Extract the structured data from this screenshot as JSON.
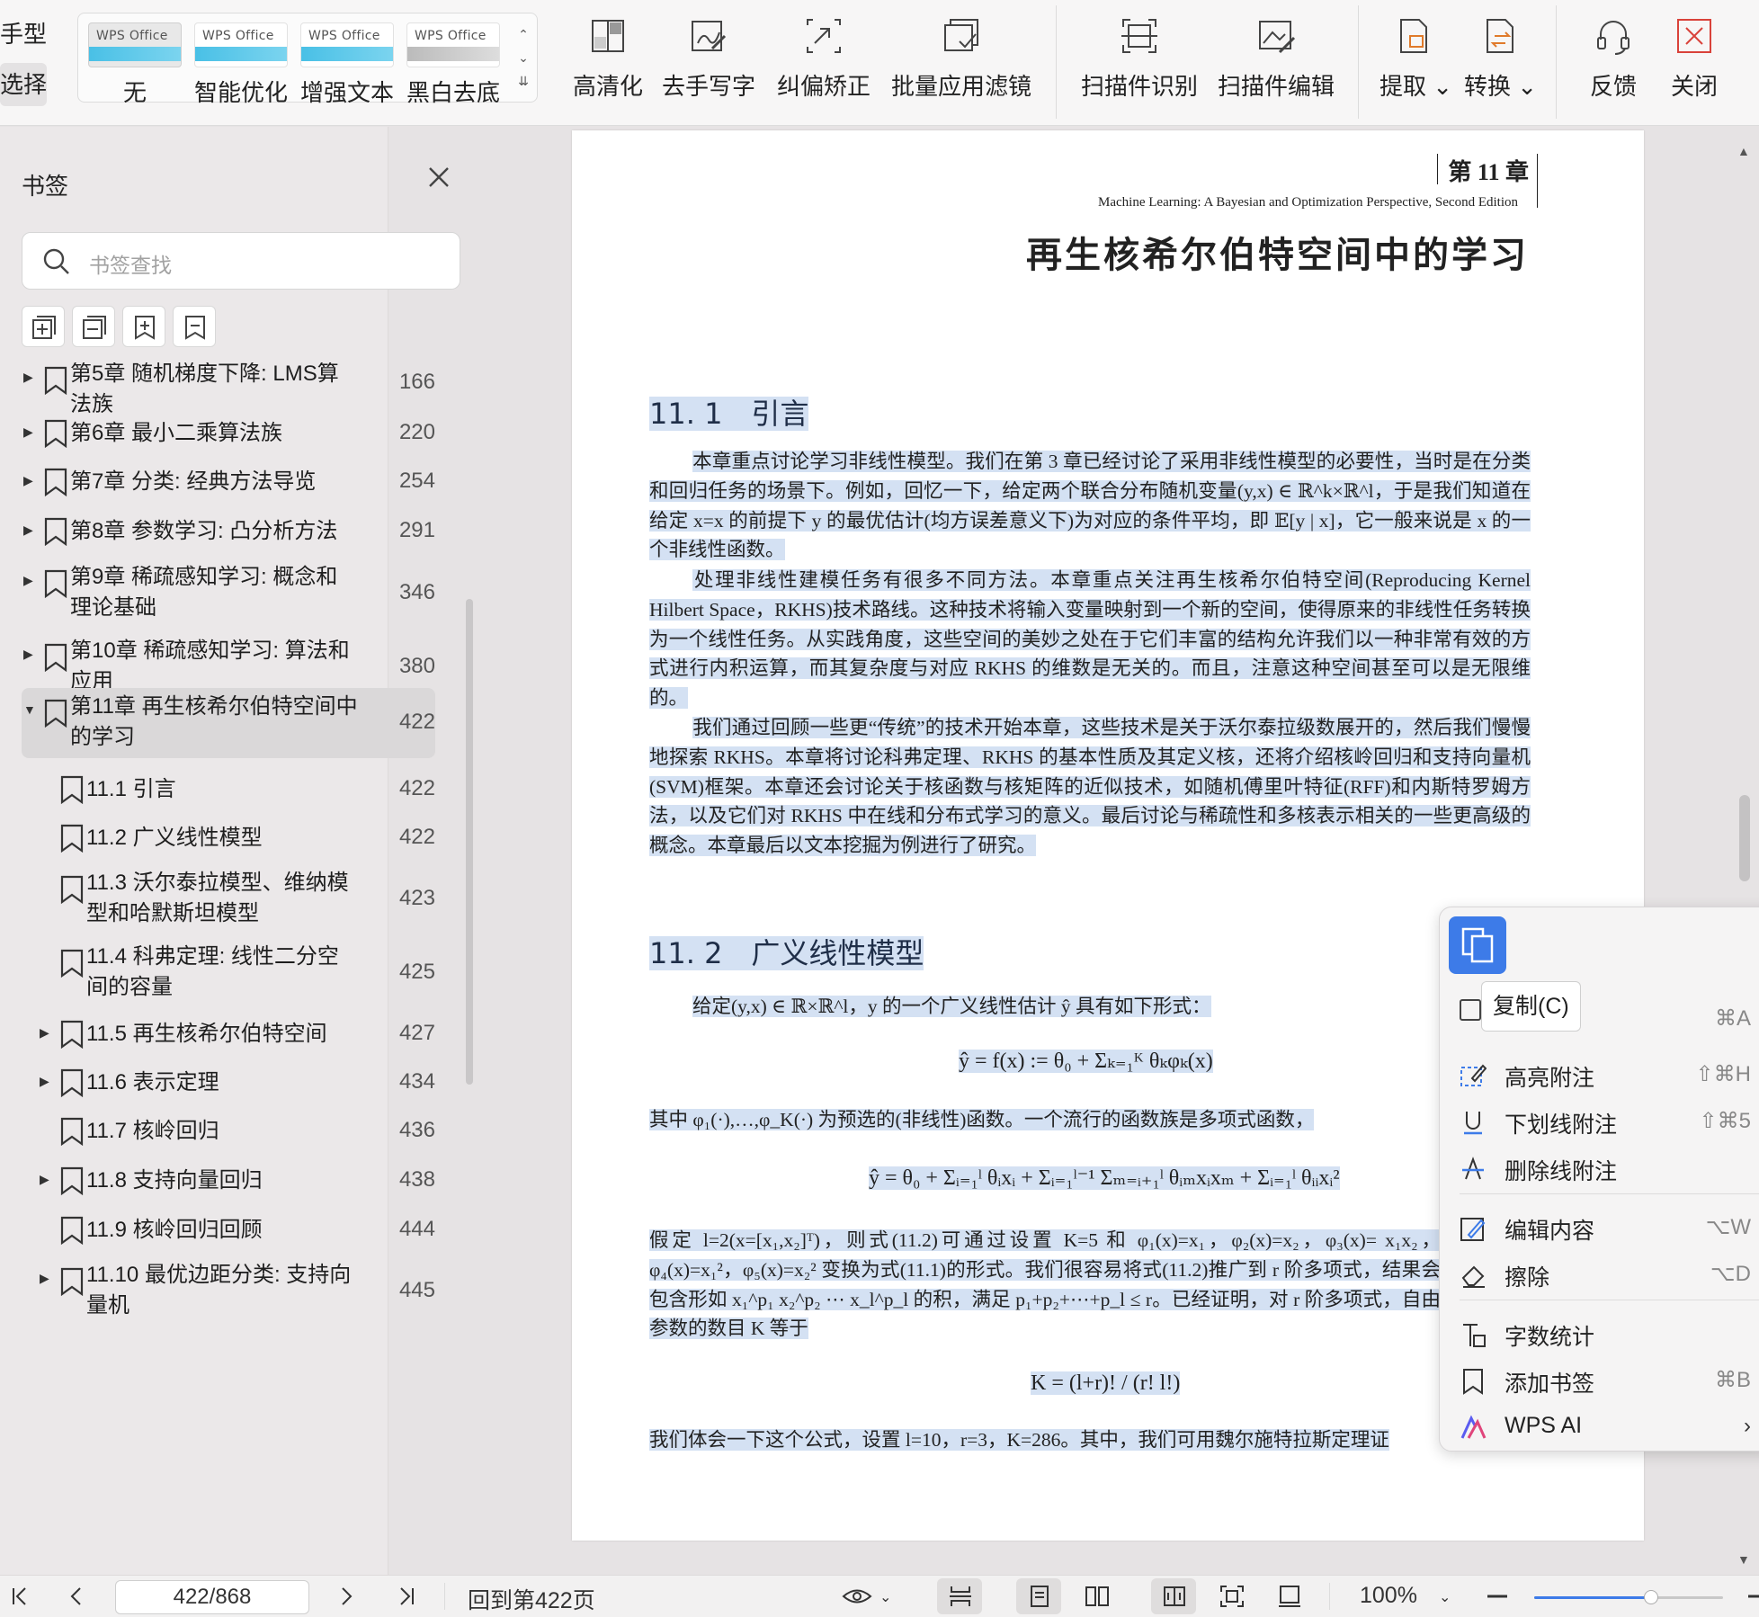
{
  "toolbar": {
    "left_cut": {
      "top": "手型",
      "bottom": "选择"
    },
    "filters": [
      {
        "label": "无",
        "thumb_text": "WPS Office"
      },
      {
        "label": "智能优化",
        "thumb_text": "WPS Office"
      },
      {
        "label": "增强文本",
        "thumb_text": "WPS Office"
      },
      {
        "label": "黑白去底",
        "thumb_text": "WPS Office"
      }
    ],
    "buttons": {
      "hd": "高清化",
      "remove_handwriting": "去手写字",
      "deskew": "纠偏矫正",
      "batch_filter": "批量应用滤镜",
      "scan_recognize": "扫描件识别",
      "scan_edit": "扫描件编辑",
      "extract": "提取",
      "convert": "转换",
      "feedback": "反馈",
      "close": "关闭"
    }
  },
  "sidebar": {
    "title": "书签",
    "search_placeholder": "书签查找",
    "bookmarks": [
      {
        "text_line1": "第5章 随机梯度下降: LMS算",
        "text_line2": "法族",
        "page": "166",
        "expandable": true,
        "level": 0
      },
      {
        "text_line1": "第6章 最小二乘算法族",
        "text_line2": "",
        "page": "220",
        "expandable": true,
        "level": 0
      },
      {
        "text_line1": "第7章 分类: 经典方法导览",
        "text_line2": "",
        "page": "254",
        "expandable": true,
        "level": 0
      },
      {
        "text_line1": "第8章 参数学习: 凸分析方法",
        "text_line2": "",
        "page": "291",
        "expandable": true,
        "level": 0
      },
      {
        "text_line1": "第9章 稀疏感知学习: 概念和",
        "text_line2": "理论基础",
        "page": "346",
        "expandable": true,
        "level": 0
      },
      {
        "text_line1": "第10章 稀疏感知学习: 算法和",
        "text_line2": "应用",
        "page": "380",
        "expandable": true,
        "level": 0
      },
      {
        "text_line1": "第11章 再生核希尔伯特空间中",
        "text_line2": "的学习",
        "page": "422",
        "expandable": true,
        "level": 0,
        "expanded": true,
        "selected": true
      },
      {
        "text_line1": "11.1 引言",
        "text_line2": "",
        "page": "422",
        "expandable": false,
        "level": 1
      },
      {
        "text_line1": "11.2 广义线性模型",
        "text_line2": "",
        "page": "422",
        "expandable": false,
        "level": 1
      },
      {
        "text_line1": "11.3 沃尔泰拉模型、维纳模",
        "text_line2": "型和哈默斯坦模型",
        "page": "423",
        "expandable": false,
        "level": 1
      },
      {
        "text_line1": "11.4 科弗定理: 线性二分空",
        "text_line2": "间的容量",
        "page": "425",
        "expandable": false,
        "level": 1
      },
      {
        "text_line1": "11.5 再生核希尔伯特空间",
        "text_line2": "",
        "page": "427",
        "expandable": true,
        "level": 1
      },
      {
        "text_line1": "11.6 表示定理",
        "text_line2": "",
        "page": "434",
        "expandable": true,
        "level": 1
      },
      {
        "text_line1": "11.7 核岭回归",
        "text_line2": "",
        "page": "436",
        "expandable": false,
        "level": 1
      },
      {
        "text_line1": "11.8 支持向量回归",
        "text_line2": "",
        "page": "438",
        "expandable": true,
        "level": 1
      },
      {
        "text_line1": "11.9 核岭回归回顾",
        "text_line2": "",
        "page": "444",
        "expandable": false,
        "level": 1
      },
      {
        "text_line1": "11.10 最优边距分类: 支持向",
        "text_line2": "量机",
        "page": "445",
        "expandable": true,
        "level": 1
      }
    ]
  },
  "document": {
    "header_chapter": "第 11 章",
    "header_subtitle": "Machine Learning: A Bayesian and Optimization Perspective, Second Edition",
    "chapter_title": "再生核希尔伯特空间中的学习",
    "sec1_title": "11. 1　引言",
    "sec1_p1": "本章重点讨论学习非线性模型。我们在第 3 章已经讨论了采用非线性模型的必要性，当时是在分类和回归任务的场景下。例如，回忆一下，给定两个联合分布随机变量(y,x) ∈ ℝ^k×ℝ^l，于是我们知道在给定 x=x 的前提下 y 的最优估计(均方误差意义下)为对应的条件平均，即 𝔼[y | x]，它一般来说是 x 的一个非线性函数。",
    "sec1_p2": "处理非线性建模任务有很多不同方法。本章重点关注再生核希尔伯特空间(Reproducing Kernel Hilbert Space，RKHS)技术路线。这种技术将输入变量映射到一个新的空间，使得原来的非线性任务转换为一个线性任务。从实践角度，这些空间的美妙之处在于它们丰富的结构允许我们以一种非常有效的方式进行内积运算，而其复杂度与对应 RKHS 的维数是无关的。而且，注意这种空间甚至可以是无限维的。",
    "sec1_p3": "我们通过回顾一些更“传统”的技术开始本章，这些技术是关于沃尔泰拉级数展开的，然后我们慢慢地探索 RKHS。本章将讨论科弗定理、RKHS 的基本性质及其定义核，还将介绍核岭回归和支持向量机(SVM)框架。本章还会讨论关于核函数与核矩阵的近似技术，如随机傅里叶特征(RFF)和内斯特罗姆方法，以及它们对 RKHS 中在线和分布式学习的意义。最后讨论与稀疏性和多核表示相关的一些更高级的概念。本章最后以文本挖掘为例进行了研究。",
    "sec2_title": "11. 2　广义线性模型",
    "sec2_p1": "给定(y,x) ∈ ℝ×ℝ^l，y 的一个广义线性估计 ŷ 具有如下形式：",
    "sec2_eq1": "ŷ = f(x) := θ₀ + Σₖ₌₁ᴷ θₖφₖ(x)",
    "sec2_p2": "其中 φ₁(·),…,φ_K(·) 为预选的(非线性)函数。一个流行的函数族是多项式函数，",
    "sec2_eq2": "ŷ = θ₀ + Σᵢ₌₁ˡ θᵢxᵢ + Σᵢ₌₁ˡ⁻¹ Σₘ₌ᵢ₊₁ˡ θᵢₘxᵢxₘ + Σᵢ₌₁ˡ θᵢᵢxᵢ²",
    "sec2_p3": "假定 l=2(x=[x₁,x₂]ᵀ)，则式(11.2)可通过设置 K=5 和 φ₁(x)=x₁，φ₂(x)=x₂，φ₃(x)= x₁x₂，φ₄(x)=x₁²，φ₅(x)=x₂² 变换为式(11.1)的形式。我们很容易将式(11.2)推广到 r 阶多项式，结果会包含形如 x₁^p₁ x₂^p₂ ⋯ x_l^p_l 的积，满足 p₁+p₂+⋯+p_l ≤ r。已经证明，对 r 阶多项式，自由参数的数目 K 等于",
    "sec2_eq3": "K = (l+r)! / (r! l!)",
    "sec2_p4": "我们体会一下这个公式，设置 l=10，r=3，K=286。其中，我们可用魏尔施特拉斯定理证",
    "eq_theta0": "θ₀",
    "eq_sum_K": "K",
    "eq_sum_k1": "k=1"
  },
  "context_menu": {
    "copy_tooltip": "复制(C)",
    "select_all_shortcut": "⌘A",
    "items": [
      {
        "label": "高亮附注",
        "shortcut": "⇧⌘H",
        "icon": "highlight-icon"
      },
      {
        "label": "下划线附注",
        "shortcut": "⇧⌘5",
        "icon": "underline-icon"
      },
      {
        "label": "删除线附注",
        "shortcut": "",
        "icon": "strikethrough-icon"
      },
      {
        "label": "编辑内容",
        "shortcut": "⌥W",
        "icon": "edit-icon"
      },
      {
        "label": "擦除",
        "shortcut": "⌥D",
        "icon": "eraser-icon"
      },
      {
        "label": "字数统计",
        "shortcut": "",
        "icon": "word-count-icon"
      },
      {
        "label": "添加书签",
        "shortcut": "⌘B",
        "icon": "bookmark-icon"
      },
      {
        "label": "WPS AI",
        "shortcut": "›",
        "icon": "wps-ai-icon"
      }
    ]
  },
  "statusbar": {
    "page_field": "422/868",
    "back_to_page": "回到第422页",
    "zoom": "100%",
    "zoom_fraction": 0.62
  }
}
